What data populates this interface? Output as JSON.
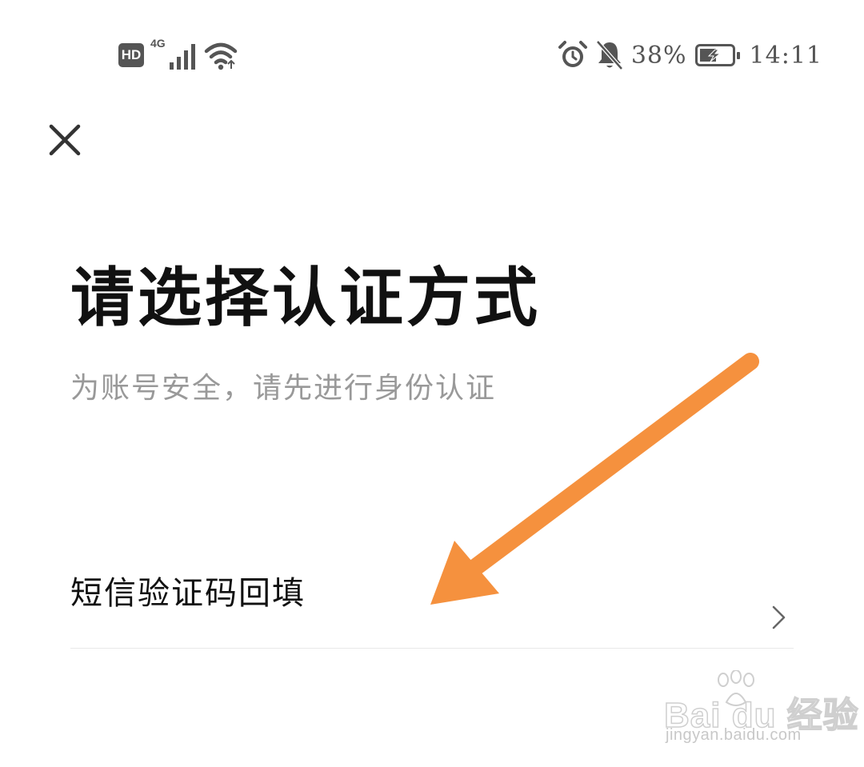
{
  "status_bar": {
    "hd_label": "HD",
    "network_type": "4G",
    "battery_percent": "38%",
    "time": "14:11",
    "icons": [
      "hd-icon",
      "signal-icon",
      "wifi-icon",
      "alarm-icon",
      "bell-muted-icon",
      "battery-charging-icon"
    ]
  },
  "header": {
    "close_icon": "close-icon"
  },
  "main": {
    "title": "请选择认证方式",
    "subtitle": "为账号安全，请先进行身份认证",
    "options": [
      {
        "label": "短信验证码回填",
        "icon": "chevron-right-icon"
      }
    ]
  },
  "annotation": {
    "arrow_color": "#f5913e"
  },
  "watermark": {
    "brand": "Bai du 经验",
    "url": "jingyan.baidu.com"
  }
}
